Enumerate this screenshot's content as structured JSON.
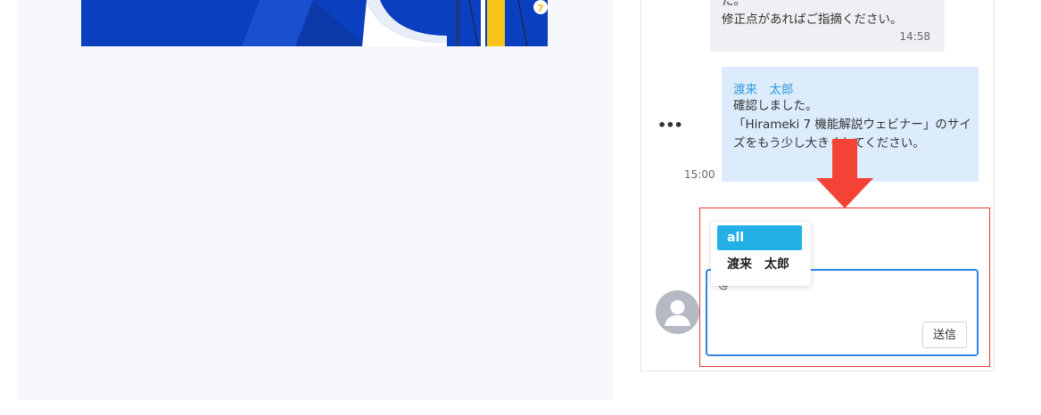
{
  "chat": {
    "self_message": {
      "text": "た。\n修正点があればご指摘ください。",
      "time": "14:58"
    },
    "other_message": {
      "sender": "渡来　太郎",
      "text": "確認しました。\n「Hirameki 7 機能解説ウェビナー」のサイズをもう少し大きくしてください。",
      "time": "15:00"
    }
  },
  "mention_popup": {
    "items": [
      "all",
      "渡来　太郎"
    ]
  },
  "composer": {
    "input_value": "@",
    "send_label": "送信"
  },
  "colors": {
    "accent": "#22b0e6",
    "input_border": "#2f86e8",
    "highlight": "#e53935",
    "arrow": "#f44336"
  }
}
